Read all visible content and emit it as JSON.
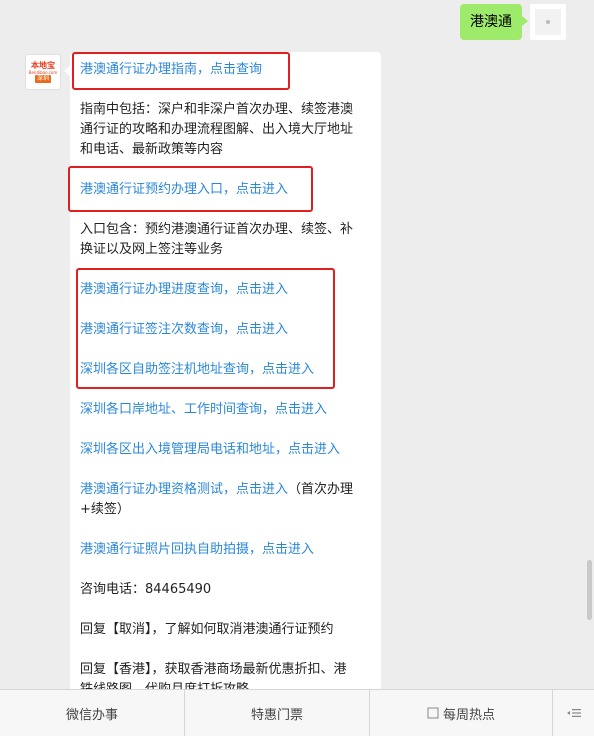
{
  "outgoing": {
    "text": "港澳通"
  },
  "bot": {
    "logo_top": "本地宝",
    "logo_mid": "Bendibao.com",
    "logo_bottom": "深圳"
  },
  "message": {
    "link1": "港澳通行证办理指南，点击查询",
    "text1_l1": "指南中包括：深户和非深户首次办理、续签港澳",
    "text1_l2": "通行证的攻略和办理流程图解、出入境大厅地址",
    "text1_l3": "和电话、最新政策等内容",
    "link2": "港澳通行证预约办理入口，点击进入",
    "text2_l1": "入口包含：预约港澳通行证首次办理、续签、补",
    "text2_l2": "换证以及网上签注等业务",
    "link3": "港澳通行证办理进度查询，点击进入",
    "link4": "港澳通行证签注次数查询，点击进入",
    "link5": "深圳各区自助签注机地址查询，点击进入",
    "link6": "深圳各口岸地址、工作时间查询，点击进入",
    "link7": "深圳各区出入境管理局电话和地址，点击进入",
    "link8": "港澳通行证办理资格测试，点击进入",
    "link8_suffix": "（首次办理",
    "link8_l2": "+续签）",
    "link9": "港澳通行证照片回执自助拍摄，点击进入",
    "phone": "咨询电话：84465490",
    "reply1": "回复【取消】，了解如何取消港澳通行证预约",
    "reply2_l1": "回复【香港】，获取香港商场最新优惠折扣、港",
    "reply2_l2": "铁线路图、代购月度打折攻略"
  },
  "menu": {
    "item1": "微信办事",
    "item2": "特惠门票",
    "item3": "每周热点",
    "item3_icon": "checkbox-icon",
    "item4_icon": "menu-lines-icon"
  },
  "colors": {
    "link": "#2b88d8",
    "outgoing_bubble": "#9eea6a",
    "highlight_box": "#e02020"
  }
}
